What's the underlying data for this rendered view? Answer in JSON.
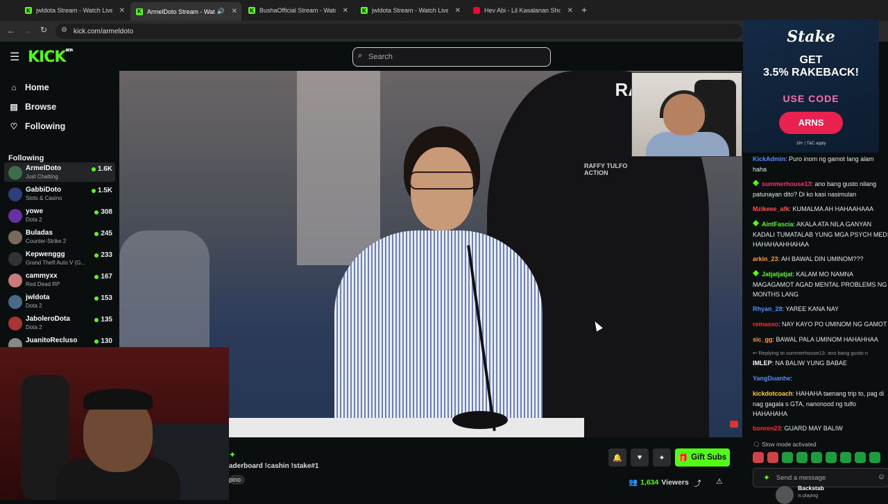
{
  "browser": {
    "tabs": [
      {
        "title": "jwldota Stream - Watch Live on",
        "icon": "kick-icon"
      },
      {
        "title": "ArmelDoto Stream - Watch",
        "icon": "kick-icon",
        "active": true
      },
      {
        "title": "BushaOfficial Stream - Watch Li",
        "icon": "kick-icon"
      },
      {
        "title": "jwldota Stream - Watch Live on",
        "icon": "kick-icon"
      },
      {
        "title": "Hev Abi - Lil Kasalanan Shortie",
        "icon": "youtube-icon"
      }
    ],
    "url": "kick.com/armeldoto"
  },
  "header": {
    "logo": "KICK",
    "logo_sup": "BETA",
    "search_placeholder": "Search"
  },
  "sidebar": {
    "nav": [
      {
        "label": "Home",
        "icon": "home-icon"
      },
      {
        "label": "Browse",
        "icon": "browse-icon"
      },
      {
        "label": "Following",
        "icon": "heart-icon"
      }
    ],
    "following_header": "Following",
    "channels": [
      {
        "name": "ArmelDoto",
        "game": "Just Chatting",
        "viewers": "1.6K",
        "color": "#3c6e4a"
      },
      {
        "name": "GabbiDoto",
        "game": "Slots & Casino",
        "viewers": "1.5K",
        "color": "#2b3f7a"
      },
      {
        "name": "yowe",
        "game": "Dota 2",
        "viewers": "308",
        "color": "#6a2fa3"
      },
      {
        "name": "Buladas",
        "game": "Counter-Strike 2",
        "viewers": "245",
        "color": "#7a6a5c"
      },
      {
        "name": "Kepwenggg",
        "game": "Grand Theft Auto V (G...",
        "viewers": "233",
        "color": "#333"
      },
      {
        "name": "cammyxx",
        "game": "Red Dead RP",
        "viewers": "167",
        "color": "#c97a7a"
      },
      {
        "name": "jwldota",
        "game": "Dota 2",
        "viewers": "153",
        "color": "#4a6a8a"
      },
      {
        "name": "JaboleroDota",
        "game": "Dota 2",
        "viewers": "135",
        "color": "#a33"
      },
      {
        "name": "JuanitoRecluso",
        "game": "",
        "viewers": "130",
        "color": "#888"
      }
    ]
  },
  "video": {
    "brand_text": "RA",
    "shirt_logo": "RAFFY TULFO\nACTION"
  },
  "ad": {
    "brand": "Stake",
    "line1": "GET",
    "line2": "3.5% RAKEBACK!",
    "use_code": "USE CODE",
    "code": "ARNS",
    "fine": "18+ | T&C apply"
  },
  "chat": {
    "messages": [
      {
        "user": "KickAdmin",
        "color": "#4f8cff",
        "text": ": Puro inom ng gamot lang alam",
        "cont": "haha",
        "badge": false
      },
      {
        "user": "summerhouse13",
        "color": "#ff2a6d",
        "text": ": ano bang gusto nilang",
        "cont": "patunayan dito? Di ko kasi nasimulan",
        "badge": true
      },
      {
        "user": "Mzikeee_afk",
        "color": "#ff4d4d",
        "text": ": KUMALMA AH HAHAAHAAA",
        "cont": "",
        "badge": false
      },
      {
        "user": "AintFascia",
        "color": "#53fc18",
        "text": ": AKALA ATA NILA GANYAN",
        "cont": "KADALI TUMATALAB YUNG MGA PSYCH MEDS",
        "cont2": "HAHAHAAHHAHAA",
        "badge": true
      },
      {
        "user": "arkin_23",
        "color": "#ff9a3c",
        "text": ": AH BAWAL DIN UMINOM???",
        "cont": "",
        "badge": false
      },
      {
        "user": "Jatjatjatjat",
        "color": "#53fc18",
        "text": ": KALAM MO NAMNA",
        "cont": "MAGAGAMOT AGAD MENTAL PROBLEMS NG",
        "cont2": "MONTHS LANG",
        "badge": true
      },
      {
        "user": "Rhyan_28",
        "color": "#4f8cff",
        "text": ": YAREE KANA NAY",
        "cont": "",
        "badge": false
      },
      {
        "user": "remasxo",
        "color": "#ff2a2a",
        "text": ": NAY KAYO PO UMINOM NG GAMOT",
        "cont": "",
        "badge": false
      },
      {
        "user": "sic_gg",
        "color": "#ff9a3c",
        "text": ": BAWAL PALA UMINOM HAHAHHAA",
        "cont": "",
        "badge": false
      },
      {
        "user": "IMLEP",
        "color": "#ffffff",
        "text": ": NA BALIW YUNG BABAE",
        "cont": "",
        "badge": false
      },
      {
        "user": "YangDuanhe",
        "color": "#4f8cff",
        "text": ":",
        "cont": "",
        "badge": false
      },
      {
        "user": "kickdotcoach",
        "color": "#ffcc33",
        "text": ": HAHAHA taenang trip to, pag di",
        "cont": "nag gagala s GTA, nanonood ng tulfo",
        "cont2": "HAHAHAHA",
        "badge": false
      },
      {
        "user": "bonren23",
        "color": "#ff2a2a",
        "text": ": GUARD MAY BALIW",
        "cont": "",
        "badge": false
      }
    ],
    "reply_note": "Replying to summerhouse13: ano bang gusto n",
    "slow_mode": "Slow mode activated",
    "send_placeholder": "Send a message",
    "activity_name": "Backstab",
    "activity_sub": "is playing"
  },
  "stream": {
    "title": "aderboard !cashin !stake#1",
    "tag": "pino",
    "viewers_count": "1,634",
    "viewers_label": "Viewers",
    "gift_label": "Gift Subs"
  }
}
